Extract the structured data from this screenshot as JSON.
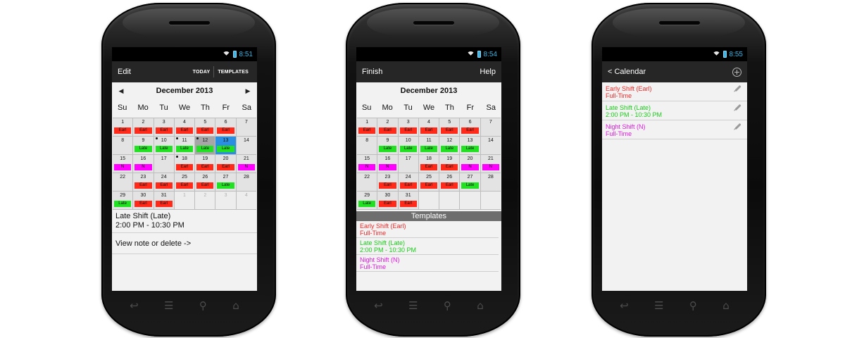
{
  "colors": {
    "early": "#ff2a1a",
    "late": "#22e022",
    "night": "#ff00ff",
    "early_text": "#ef2b2b",
    "late_text": "#1ccc1c",
    "night_text": "#e01be0"
  },
  "phone1": {
    "status_time": "8:51",
    "action_bar": {
      "title": "Edit",
      "today": "TODAY",
      "templates": "TEMPLATES"
    },
    "calendar": {
      "month": "December 2013",
      "prev_icon": "triangle-left",
      "next_icon": "triangle-right",
      "days_of_week": [
        "Su",
        "Mo",
        "Tu",
        "We",
        "Th",
        "Fr",
        "Sa"
      ],
      "cells": [
        {
          "n": "1",
          "t": "Earl",
          "c": "early"
        },
        {
          "n": "2",
          "t": "Earl",
          "c": "early"
        },
        {
          "n": "3",
          "t": "Earl",
          "c": "early"
        },
        {
          "n": "4",
          "t": "Earl",
          "c": "early"
        },
        {
          "n": "5",
          "t": "Earl",
          "c": "early"
        },
        {
          "n": "6",
          "t": "Earl",
          "c": "early"
        },
        {
          "n": "7"
        },
        {
          "n": "8"
        },
        {
          "n": "9",
          "t": "Late",
          "c": "late"
        },
        {
          "n": "10",
          "t": "Late",
          "c": "late",
          "dot": true
        },
        {
          "n": "11",
          "t": "Late",
          "c": "late",
          "dot": true
        },
        {
          "n": "12",
          "t": "Late",
          "c": "late",
          "dot": true,
          "state": "sel"
        },
        {
          "n": "13",
          "t": "Late",
          "c": "late",
          "state": "today"
        },
        {
          "n": "14"
        },
        {
          "n": "15",
          "t": "N",
          "c": "night"
        },
        {
          "n": "16",
          "t": "N",
          "c": "night"
        },
        {
          "n": "17"
        },
        {
          "n": "18",
          "t": "Earl",
          "c": "early",
          "dot": true
        },
        {
          "n": "19",
          "t": "Earl",
          "c": "early"
        },
        {
          "n": "20",
          "t": "Earl",
          "c": "early"
        },
        {
          "n": "21",
          "t": "N",
          "c": "night"
        },
        {
          "n": "22"
        },
        {
          "n": "23",
          "t": "Earl",
          "c": "early"
        },
        {
          "n": "24",
          "t": "Earl",
          "c": "early"
        },
        {
          "n": "25",
          "t": "Earl",
          "c": "early"
        },
        {
          "n": "26",
          "t": "Earl",
          "c": "early"
        },
        {
          "n": "27",
          "t": "Late",
          "c": "late"
        },
        {
          "n": "28"
        },
        {
          "n": "29",
          "t": "Late",
          "c": "late"
        },
        {
          "n": "30",
          "t": "Earl",
          "c": "early"
        },
        {
          "n": "31",
          "t": "Earl",
          "c": "early"
        },
        {
          "n": "1",
          "state": "other"
        },
        {
          "n": "2",
          "state": "other"
        },
        {
          "n": "3",
          "state": "other"
        },
        {
          "n": "4",
          "state": "other"
        }
      ]
    },
    "detail": {
      "name": "Late Shift (Late)",
      "time": "2:00  PM - 10:30  PM"
    },
    "note_link": "View note or delete ->"
  },
  "phone2": {
    "status_time": "8:54",
    "action_bar": {
      "title": "Finish",
      "help": "Help"
    },
    "calendar": {
      "month": "December 2013",
      "days_of_week": [
        "Su",
        "Mo",
        "Tu",
        "We",
        "Th",
        "Fr",
        "Sa"
      ],
      "cells": [
        {
          "n": "1",
          "t": "Earl",
          "c": "early"
        },
        {
          "n": "2",
          "t": "Earl",
          "c": "early"
        },
        {
          "n": "3",
          "t": "Earl",
          "c": "early"
        },
        {
          "n": "4",
          "t": "Earl",
          "c": "early"
        },
        {
          "n": "5",
          "t": "Earl",
          "c": "early"
        },
        {
          "n": "6",
          "t": "Earl",
          "c": "early"
        },
        {
          "n": "7"
        },
        {
          "n": "8"
        },
        {
          "n": "9",
          "t": "Late",
          "c": "late"
        },
        {
          "n": "10",
          "t": "Late",
          "c": "late"
        },
        {
          "n": "11",
          "t": "Late",
          "c": "late"
        },
        {
          "n": "12",
          "t": "Late",
          "c": "late"
        },
        {
          "n": "13",
          "t": "Late",
          "c": "late"
        },
        {
          "n": "14"
        },
        {
          "n": "15",
          "t": "N",
          "c": "night"
        },
        {
          "n": "16",
          "t": "N",
          "c": "night"
        },
        {
          "n": "17"
        },
        {
          "n": "18",
          "t": "Earl",
          "c": "early"
        },
        {
          "n": "19",
          "t": "Earl",
          "c": "early"
        },
        {
          "n": "20",
          "t": "N",
          "c": "night"
        },
        {
          "n": "21",
          "t": "N",
          "c": "night"
        },
        {
          "n": "22"
        },
        {
          "n": "23",
          "t": "Earl",
          "c": "early"
        },
        {
          "n": "24",
          "t": "Earl",
          "c": "early"
        },
        {
          "n": "25",
          "t": "Earl",
          "c": "early"
        },
        {
          "n": "26",
          "t": "Earl",
          "c": "early"
        },
        {
          "n": "27",
          "t": "Late",
          "c": "late"
        },
        {
          "n": "28"
        },
        {
          "n": "29",
          "t": "Late",
          "c": "late"
        },
        {
          "n": "30",
          "t": "Earl",
          "c": "early"
        },
        {
          "n": "31",
          "t": "Earl",
          "c": "early"
        }
      ]
    },
    "templates_header": "Templates",
    "templates": [
      {
        "line1": "Early Shift (Earl)",
        "line2": "Full-Time",
        "c": "early_text"
      },
      {
        "line1": "Late Shift (Late)",
        "line2": "2:00  PM - 10:30  PM",
        "c": "late_text"
      },
      {
        "line1": "Night Shift (N)",
        "line2": "Full-Time",
        "c": "night_text"
      }
    ]
  },
  "phone3": {
    "status_time": "8:55",
    "action_bar": {
      "back_title": "< Calendar",
      "add_icon": "plus-circle-icon"
    },
    "templates": [
      {
        "line1": "Early Shift (Earl)",
        "line2": "Full-Time",
        "c": "early_text"
      },
      {
        "line1": "Late Shift (Late)",
        "line2": "2:00  PM - 10:30  PM",
        "c": "late_text"
      },
      {
        "line1": "Night Shift (N)",
        "line2": "Full-Time",
        "c": "night_text"
      }
    ]
  },
  "nav_keys": [
    "back-icon",
    "menu-icon",
    "search-icon",
    "home-icon"
  ]
}
